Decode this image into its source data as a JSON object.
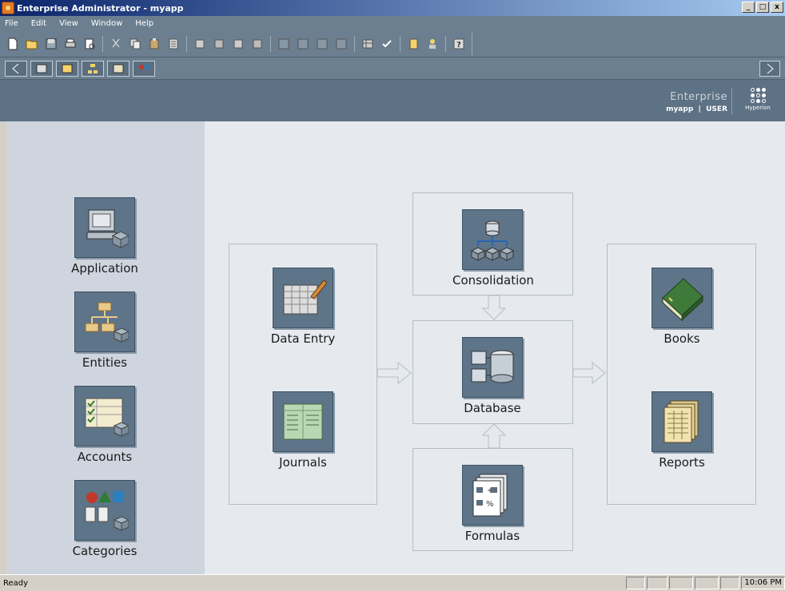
{
  "window": {
    "title": "Enterprise Administrator - myapp",
    "controls": [
      "_",
      "□",
      "x"
    ]
  },
  "menu": {
    "items": [
      {
        "label": "File"
      },
      {
        "label": "Edit"
      },
      {
        "label": "View"
      },
      {
        "label": "Window"
      },
      {
        "label": "Help"
      }
    ]
  },
  "toolbar": {
    "icons": [
      "new-icon",
      "open-icon",
      "save-icon",
      "print-icon",
      "print-preview-icon",
      "cut-icon",
      "copy-icon",
      "paste-icon",
      "properties-icon",
      "import-icon",
      "export-icon",
      "extract-icon",
      "load-icon",
      "grid-icon",
      "view-icon",
      "form-icon",
      "report-icon",
      "table-icon",
      "check-icon",
      "document-icon",
      "users-icon",
      "help-icon"
    ]
  },
  "navbar": {
    "icons": [
      "back-icon",
      "application-icon",
      "folder-icon",
      "entities-icon",
      "accounts-icon",
      "categories-icon",
      "forward-icon"
    ]
  },
  "header": {
    "brand": "Enterprise",
    "app_name": "myapp",
    "separator": "|",
    "user": "USER",
    "vendor": "Hyperion"
  },
  "sidebar": {
    "tiles": [
      {
        "label": "Application"
      },
      {
        "label": "Entities"
      },
      {
        "label": "Accounts"
      },
      {
        "label": "Categories"
      }
    ]
  },
  "workflow": {
    "data_entry": "Data Entry",
    "journals": "Journals",
    "consolidation": "Consolidation",
    "database": "Database",
    "formulas": "Formulas",
    "books": "Books",
    "reports": "Reports"
  },
  "status": {
    "text": "Ready",
    "clock": "10:06 PM"
  },
  "colors": {
    "chrome": "#6b7f90",
    "header": "#5d7284",
    "sidebar": "#cfd5df",
    "main": "#e6eaef",
    "tile": "#5e7488"
  }
}
